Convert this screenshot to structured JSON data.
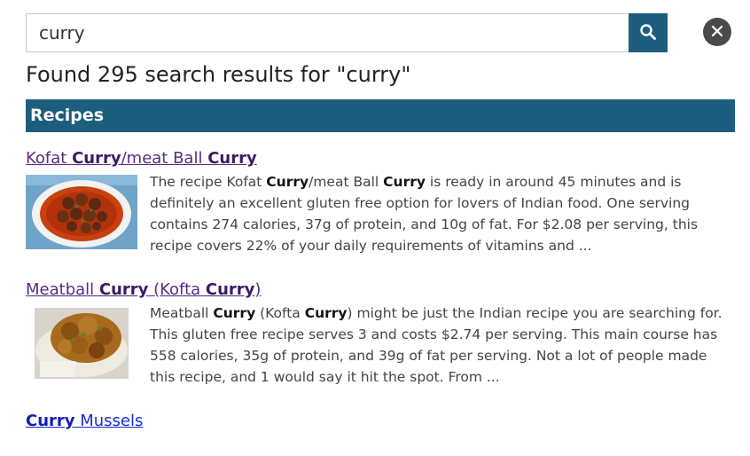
{
  "search": {
    "value": "curry",
    "placeholder": ""
  },
  "results_heading": "Found 295 search results for \"curry\"",
  "section": {
    "title": "Recipes"
  },
  "results": [
    {
      "title_parts": [
        "Kofat ",
        "Curry",
        "/meat Ball ",
        "Curry"
      ],
      "snippet_parts": [
        "The recipe Kofat ",
        "Curry",
        "/meat Ball ",
        "Curry",
        " is ready in around 45 minutes and is definitely an excellent gluten free option for lovers of Indian food. One serving contains 274 calories, 37g of protein, and 10g of fat. For $2.08 per serving, this recipe covers 22% of your daily requirements of vitamins and ..."
      ]
    },
    {
      "title_parts": [
        "Meatball ",
        "Curry",
        " (Kofta ",
        "Curry",
        ")"
      ],
      "snippet_parts": [
        "Meatball ",
        "Curry",
        " (Kofta ",
        "Curry",
        ") might be just the Indian recipe you are searching for. This gluten free recipe serves 3 and costs $2.74 per serving. This main course has 558 calories, 35g of protein, and 39g of fat per serving. Not a lot of people made this recipe, and 1 would say it hit the spot. From ..."
      ]
    },
    {
      "title_parts": [
        "Curry",
        " Mussels"
      ]
    }
  ],
  "colors": {
    "accent": "#1d5e7e",
    "close_button": "#4a4a4a",
    "visited_link": "#5a2a82",
    "link": "#1a2ad6"
  },
  "icons": {
    "search_button": "search-icon",
    "close_button": "close-icon"
  }
}
